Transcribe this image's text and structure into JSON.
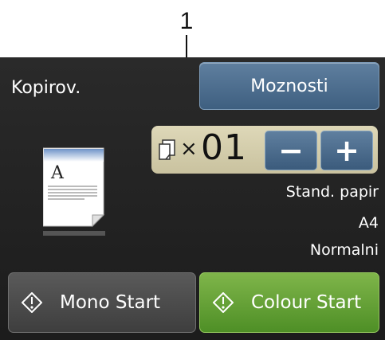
{
  "callout": {
    "number": "1"
  },
  "screen": {
    "title": "Kopirov.",
    "options_label": "Moznosti",
    "copies": {
      "multiplier": "×",
      "value": "01",
      "minus_label": "−",
      "plus_label": "+"
    },
    "preview": {
      "letter": "A"
    },
    "settings": [
      "Stand. papir",
      "A4",
      "Normalni"
    ],
    "mono_start_label": "Mono Start",
    "colour_start_label": "Colour Start"
  },
  "icons": [
    "copies-icon",
    "document-preview-icon",
    "start-diamond-icon"
  ],
  "colors": {
    "screen_bg": "#222222",
    "option_button": "#4b6b8b",
    "copies_panel": "#d6cfad",
    "mono_button": "#4a4a4a",
    "colour_button": "#62a235"
  }
}
